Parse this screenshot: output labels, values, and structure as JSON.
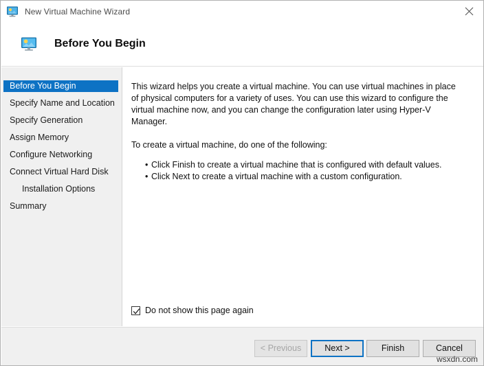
{
  "window": {
    "title": "New Virtual Machine Wizard",
    "title_icon": "virtual-machine-monitor-icon",
    "close_label": "close-icon"
  },
  "header": {
    "icon": "virtual-machine-monitor-icon",
    "title": "Before You Begin"
  },
  "sidebar": {
    "items": [
      {
        "label": "Before You Begin",
        "selected": true,
        "indent": false
      },
      {
        "label": "Specify Name and Location",
        "selected": false,
        "indent": false
      },
      {
        "label": "Specify Generation",
        "selected": false,
        "indent": false
      },
      {
        "label": "Assign Memory",
        "selected": false,
        "indent": false
      },
      {
        "label": "Configure Networking",
        "selected": false,
        "indent": false
      },
      {
        "label": "Connect Virtual Hard Disk",
        "selected": false,
        "indent": false
      },
      {
        "label": "Installation Options",
        "selected": false,
        "indent": true
      },
      {
        "label": "Summary",
        "selected": false,
        "indent": false
      }
    ]
  },
  "content": {
    "intro": "This wizard helps you create a virtual machine. You can use virtual machines in place of physical computers for a variety of uses. You can use this wizard to configure the virtual machine now, and you can change the configuration later using Hyper-V Manager.",
    "instruction": "To create a virtual machine, do one of the following:",
    "bullets": [
      "Click Finish to create a virtual machine that is configured with default values.",
      "Click Next to create a virtual machine with a custom configuration."
    ]
  },
  "checkbox": {
    "label": "Do not show this page again",
    "checked": true
  },
  "footer": {
    "buttons": [
      {
        "label": "< Previous",
        "state": "disabled"
      },
      {
        "label": "Next >",
        "state": "focused"
      },
      {
        "label": "Finish",
        "state": "normal"
      },
      {
        "label": "Cancel",
        "state": "normal"
      }
    ]
  },
  "watermark": "wsxdn.com",
  "colors": {
    "accent": "#0d72c4",
    "sidebar_bg": "#f0f0f0",
    "footer_bg": "#f0f0f0",
    "button_bg": "#e1e1e1",
    "text": "#101010"
  }
}
